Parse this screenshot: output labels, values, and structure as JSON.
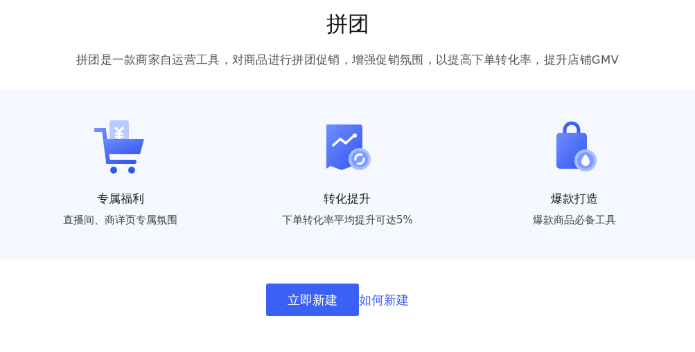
{
  "title": "拼团",
  "description": "拼团是一款商家自运营工具，对商品进行拼团促销，增强促销氛围，以提高下单转化率，提升店铺GMV",
  "features": [
    {
      "title": "专属福利",
      "subtitle": "直播间、商详页专属氛围"
    },
    {
      "title": "转化提升",
      "subtitle": "下单转化率平均提升可达5%"
    },
    {
      "title": "爆款打造",
      "subtitle": "爆款商品必备工具"
    }
  ],
  "primary_button": "立即新建",
  "help_link": "如何新建"
}
